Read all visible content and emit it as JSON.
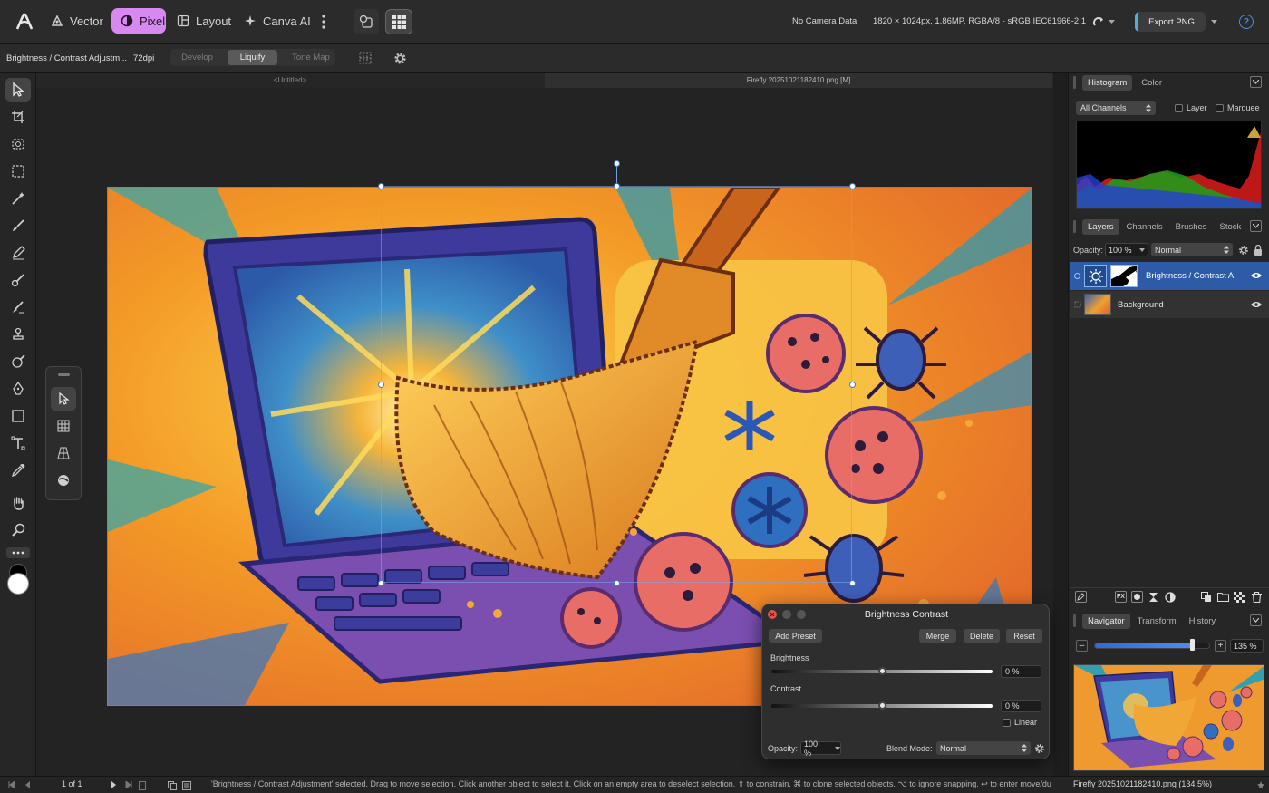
{
  "topbar": {
    "personas": [
      {
        "label": "Vector"
      },
      {
        "label": "Pixel"
      },
      {
        "label": "Layout"
      },
      {
        "label": "Canva AI"
      }
    ],
    "camera": "No Camera Data",
    "docinfo": "1820 × 1024px, 1.86MP, RGBA/8 - sRGB IEC61966-2.1",
    "export": "Export PNG",
    "help": "?"
  },
  "context": {
    "layer_name": "Brightness / Contrast Adjustm...",
    "dpi": "72dpi",
    "modes": [
      "Develop",
      "Liquify",
      "Tone Map"
    ]
  },
  "tabs": {
    "untitled": "<Untitled>",
    "active": "Firefly 20251021182410.png [M]"
  },
  "histogram": {
    "tabs": [
      "Histogram",
      "Color"
    ],
    "channel": "All Channels",
    "layer": "Layer",
    "marquee": "Marquee"
  },
  "layers": {
    "tabs": [
      "Layers",
      "Channels",
      "Brushes",
      "Stock"
    ],
    "opacity_label": "Opacity:",
    "opacity": "100 %",
    "blend": "Normal",
    "rows": [
      {
        "name": "Brightness / Contrast A"
      },
      {
        "name": "Background"
      }
    ],
    "fx": "FX"
  },
  "navigator": {
    "tabs": [
      "Navigator",
      "Transform",
      "History"
    ],
    "zoom": "135 %",
    "zoom_level": 0.84,
    "minus": "–",
    "plus": "+"
  },
  "dialog": {
    "title": "Brightness Contrast",
    "buttons": {
      "add_preset": "Add Preset",
      "merge": "Merge",
      "delete": "Delete",
      "reset": "Reset"
    },
    "brightness_label": "Brightness",
    "brightness_value": "0 %",
    "contrast_label": "Contrast",
    "contrast_value": "0 %",
    "linear": "Linear",
    "opacity_label": "Opacity:",
    "opacity": "100 %",
    "blend_label": "Blend Mode:",
    "blend": "Normal"
  },
  "status": {
    "pages": "1 of 1",
    "message": "'Brightness / Contrast Adjustment' selected. Drag to move selection. Click another object to select it. Click on an empty area to deselect selection. ⇧ to constrain. ⌘ to clone selected objects. ⌥ to ignore snapping. ↩ to enter move/du",
    "file": "Firefly 20251021182410.png (134.5%)"
  },
  "colors": {
    "accent": "#3d7dd6",
    "pixel_persona": "#d889ef",
    "layer_selected": "#2e5ba8"
  }
}
